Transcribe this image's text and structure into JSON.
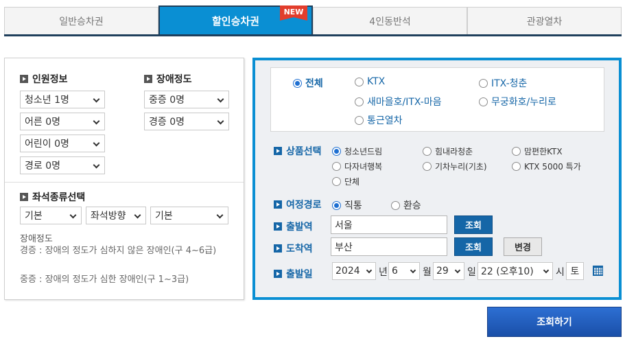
{
  "tabs": [
    {
      "label": "일반승차권",
      "active": false
    },
    {
      "label": "할인승차권",
      "active": true,
      "badge": "NEW"
    },
    {
      "label": "4인동반석",
      "active": false
    },
    {
      "label": "관광열차",
      "active": false
    }
  ],
  "left": {
    "passenger_title": "인원정보",
    "passengers": [
      "청소년 1명",
      "어른 0명",
      "어린이 0명",
      "경로 0명"
    ],
    "disability_title": "장애정도",
    "disability": [
      "중증 0명",
      "경증 0명"
    ],
    "seat_title": "좌석종류선택",
    "seat_selects": [
      "기본",
      "좌석방향",
      "기본"
    ],
    "desc_title": "장애정도",
    "desc_lines": [
      "경증 : 장애의 정도가 심하지 않은 장애인(구 4~6급)",
      "중증 : 장애의 정도가 심한 장애인(구 1~3급)"
    ]
  },
  "right": {
    "train_types": [
      "전체",
      "KTX",
      "ITX-청춘",
      "새마을호/ITX-마음",
      "무궁화호/누리로",
      "통근열차"
    ],
    "train_selected": "전체",
    "product_label": "상품선택",
    "products": [
      "청소년드림",
      "힘내라청춘",
      "맘편한KTX",
      "다자녀행복",
      "기차누리(기초)",
      "KTX 5000 특가",
      "단체"
    ],
    "product_selected": "청소년드림",
    "route_label": "여정경로",
    "routes": [
      "직통",
      "환승"
    ],
    "route_selected": "직통",
    "depart_label": "출발역",
    "depart_value": "서울",
    "arrive_label": "도착역",
    "arrive_value": "부산",
    "lookup_label": "조회",
    "change_label": "변경",
    "date_label": "출발일",
    "year": "2024",
    "year_unit": "년",
    "month": "6",
    "month_unit": "월",
    "day": "29",
    "day_unit": "일",
    "hour": "22 (오후10)",
    "hour_unit": "시",
    "weekday": "토"
  },
  "search_button": "조회하기",
  "colors": {
    "accent": "#0a8fd3",
    "navy": "#1f3f5c",
    "link": "#1566a7",
    "badge": "#e23d2c"
  }
}
